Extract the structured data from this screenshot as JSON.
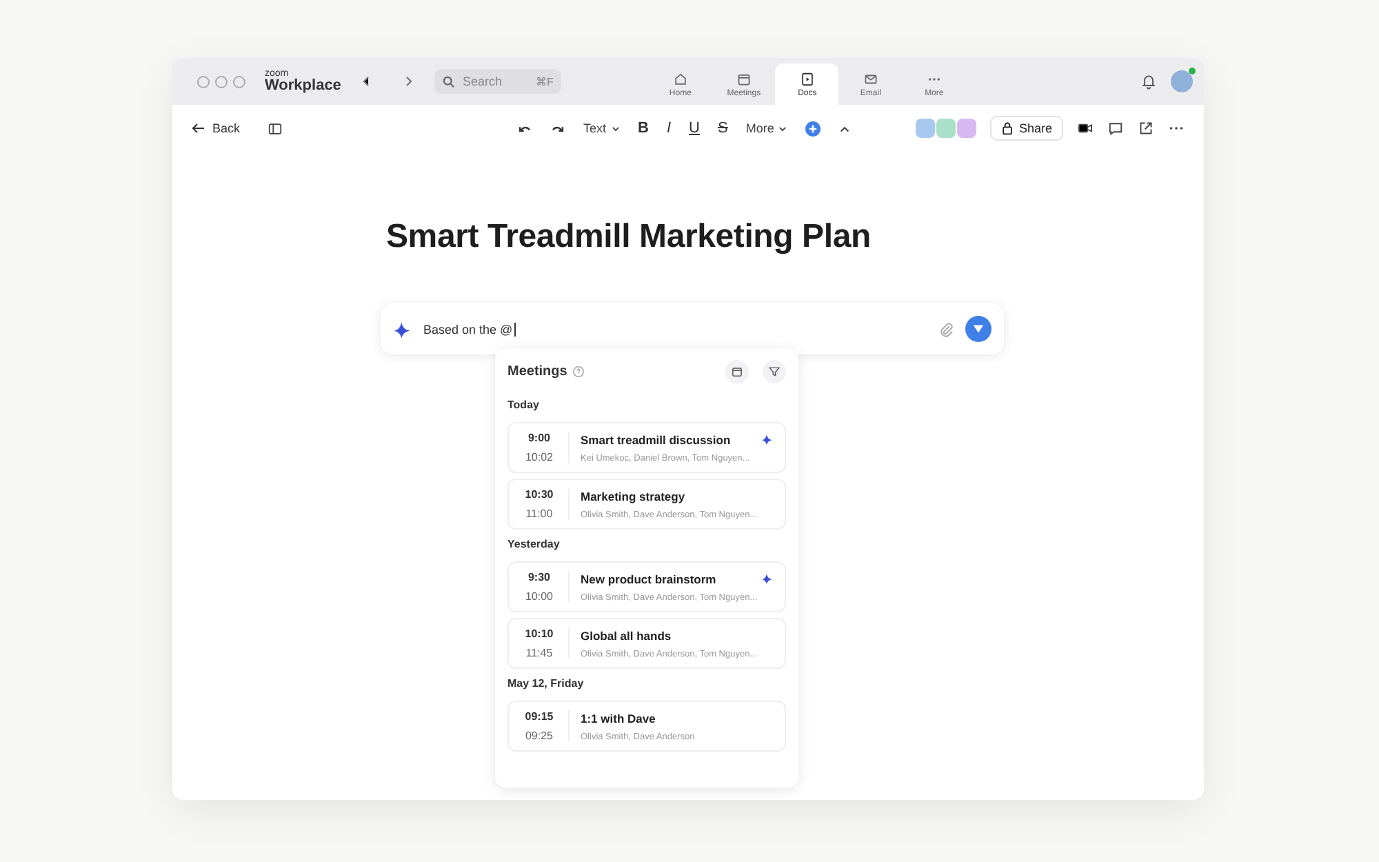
{
  "app": {
    "brand_small": "zoom",
    "brand": "Workplace"
  },
  "search": {
    "placeholder": "Search",
    "shortcut": "⌘F"
  },
  "tabs": [
    {
      "label": "Home",
      "selected": false
    },
    {
      "label": "Meetings",
      "selected": false
    },
    {
      "label": "Docs",
      "selected": true
    },
    {
      "label": "Email",
      "selected": false
    },
    {
      "label": "More",
      "selected": false
    }
  ],
  "toolbar": {
    "back": "Back",
    "text_style": "Text",
    "format": [
      "B",
      "I",
      "U",
      "S"
    ],
    "more": "More",
    "share": "Share"
  },
  "collaborators": [
    {
      "color": "#a8c8f0"
    },
    {
      "color": "#a8e0c8"
    },
    {
      "color": "#d8b8f0"
    }
  ],
  "document": {
    "title": "Smart Treadmill Marketing Plan"
  },
  "prompt": {
    "value": "Based on the @"
  },
  "meetings_panel": {
    "title": "Meetings",
    "groups": [
      {
        "label": "Today",
        "meetings": [
          {
            "start": "9:00",
            "end": "10:02",
            "title": "Smart treadmill discussion",
            "participants": "Kei Umekoc, Daniel Brown, Tom Nguyen...",
            "ai": true
          },
          {
            "start": "10:30",
            "end": "11:00",
            "title": "Marketing strategy",
            "participants": "Olivia Smith, Dave Anderson, Tom Nguyen...",
            "ai": false
          }
        ]
      },
      {
        "label": "Yesterday",
        "meetings": [
          {
            "start": "9:30",
            "end": "10:00",
            "title": "New product brainstorm",
            "participants": "Olivia Smith, Dave Anderson, Tom Nguyen...",
            "ai": true
          },
          {
            "start": "10:10",
            "end": "11:45",
            "title": "Global all hands",
            "participants": "Olivia Smith, Dave Anderson, Tom Nguyen...",
            "ai": false
          }
        ]
      },
      {
        "label": "May 12, Friday",
        "meetings": [
          {
            "start": "09:15",
            "end": "09:25",
            "title": "1:1 with Dave",
            "participants": "Olivia Smith, Dave Anderson",
            "ai": false
          }
        ]
      }
    ]
  }
}
